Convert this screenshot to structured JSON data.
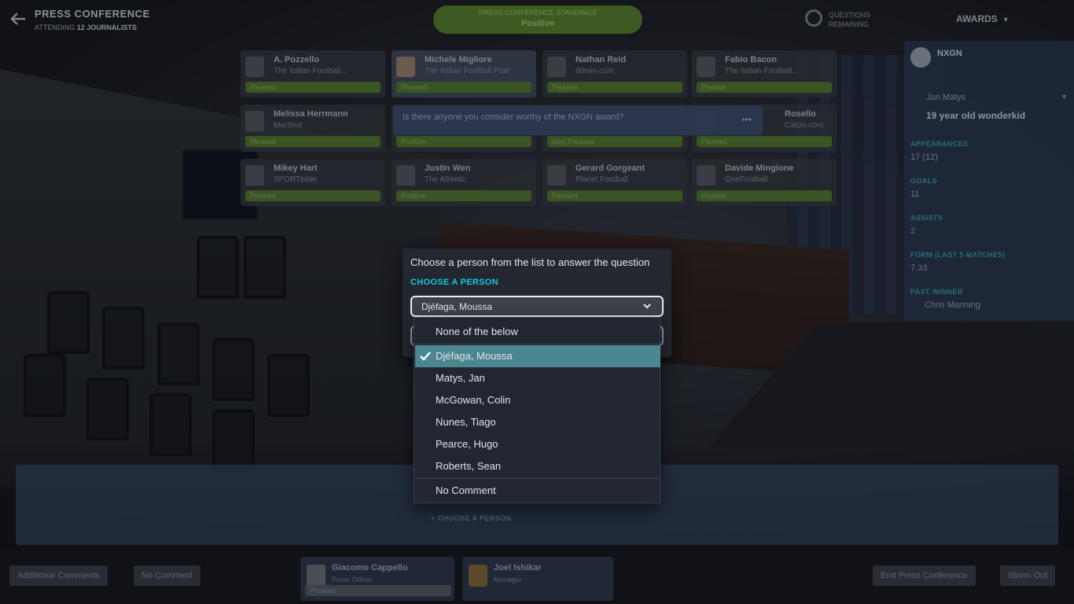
{
  "header": {
    "title": "PRESS CONFERENCE",
    "subtitle_prefix": "ATTENDING",
    "subtitle_count": "12 JOURNALISTS",
    "status_line": "PRESS CONFERENCE STANDINGS",
    "status_value": "Positive",
    "questions_label": "QUESTIONS",
    "questions_sub": "REMAINING",
    "awards_label": "AWARDS"
  },
  "journalists": [
    {
      "name": "A. Pozzello",
      "outlet": "The Italian Football...",
      "status": "Pleased"
    },
    {
      "name": "Michele Migliore",
      "outlet": "The Italian Football Post",
      "status": "Pleased"
    },
    {
      "name": "Nathan Reid",
      "outlet": "90min.com",
      "status": "Pleased"
    },
    {
      "name": "Fabio Bacon",
      "outlet": "The Italian Football...",
      "status": "Positive"
    },
    {
      "name": "Melissa Herrmann",
      "outlet": "Manfoot",
      "status": "Pleased"
    },
    {
      "name": "Mikey Hart",
      "outlet": "SPORTbible",
      "status": "Pleased"
    },
    {
      "name": "Justin Wen",
      "outlet": "The Athletic",
      "status": "Positive"
    },
    {
      "name": "Gerard Gorgeant",
      "outlet": "Planet Football",
      "status": "Pleased"
    },
    {
      "name": "Davide Mingione",
      "outlet": "OneFootball",
      "status": "Positive"
    },
    {
      "name": "Rosello",
      "outlet": "Calcio.com",
      "status": "Pleased"
    }
  ],
  "question": {
    "text": "Is there anyone you consider worthy of the NXGN award?",
    "more": "•••",
    "status_a": "Positive",
    "status_b": "Very Pleased"
  },
  "player_panel": {
    "award": "NXGN",
    "player_name": "Jan Matys",
    "tagline": "19 year old wonderkid",
    "stats": [
      {
        "label": "APPEARANCES",
        "value": "17 (12)"
      },
      {
        "label": "GOALS",
        "value": "11"
      },
      {
        "label": "ASSISTS",
        "value": "2"
      },
      {
        "label": "FORM (LAST 5 MATCHES)",
        "value": "7.33"
      },
      {
        "label": "PAST WINNER",
        "value": "Chris Manning"
      }
    ]
  },
  "modal": {
    "question": "Choose a person from the list to answer the question",
    "label": "CHOOSE A PERSON",
    "selected": "Djéfaga, Moussa"
  },
  "dropdown": {
    "top_option": "None of the below",
    "options": [
      "Djéfaga, Moussa",
      "Matys, Jan",
      "McGowan, Colin",
      "Nunes, Tiago",
      "Pearce, Hugo",
      "Roberts, Sean"
    ],
    "selected_index": 0,
    "bottom_option": "No Comment"
  },
  "answer_area": {
    "choose_person_link": "CHOOSE A PERSON"
  },
  "bottom_bar": {
    "additional_comments": "Additional Comments",
    "no_comment": "No Comment",
    "end_conference": "End Press Conference",
    "storm_out": "Storm Out",
    "staff": [
      {
        "name": "Giacomo Cappello",
        "role": "Press Officer",
        "bar": "Pleased"
      },
      {
        "name": "Joel Ishikar",
        "role": "Manager",
        "bar": ""
      }
    ]
  },
  "colors": {
    "accent_cyan": "#19c6dc",
    "selected_row": "#4a8791",
    "modal_bg": "#232730",
    "positive_green": "#3b5424"
  },
  "icons": {
    "back": "arrow-left-icon",
    "check": "check-icon",
    "chevron": "chevron-down-icon"
  }
}
